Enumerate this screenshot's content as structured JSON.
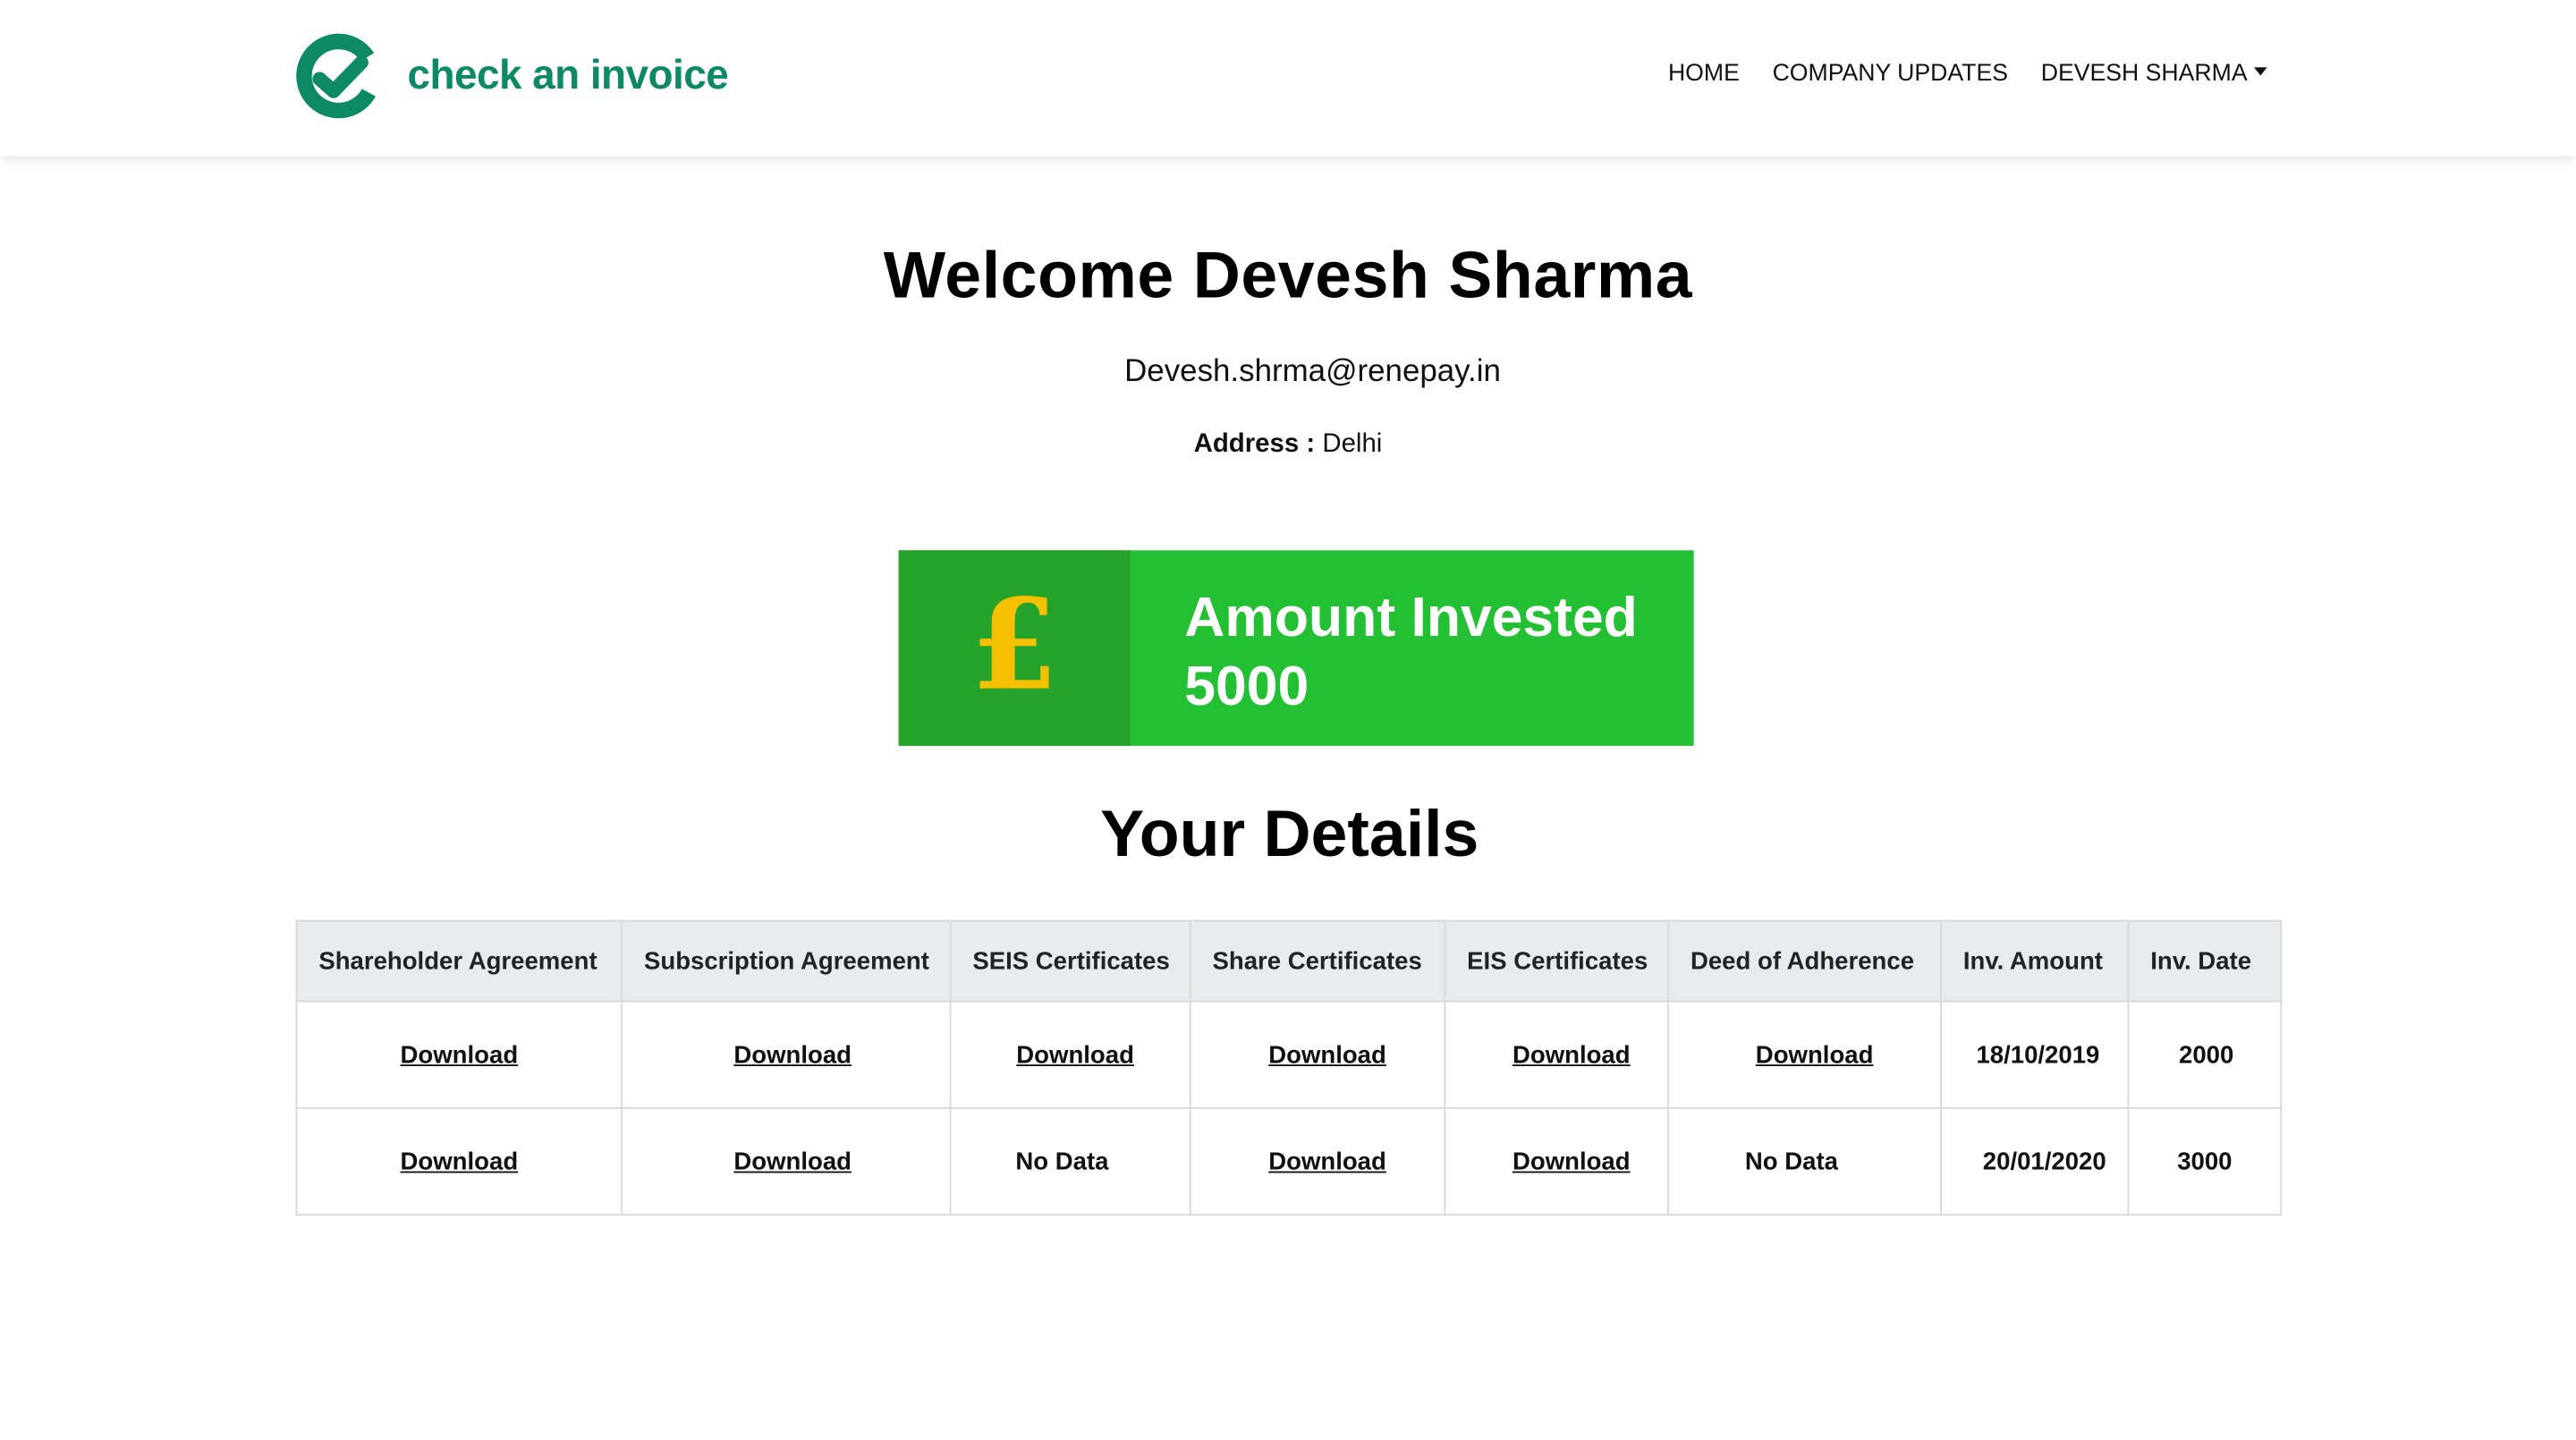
{
  "brand": {
    "name": "check an invoice"
  },
  "nav": {
    "home": "HOME",
    "company_updates": "COMPANY UPDATES",
    "user_menu": "DEVESH SHARMA"
  },
  "profile": {
    "welcome": "Welcome Devesh Sharma",
    "email": "Devesh.shrma@renepay.in",
    "address_label": "Address :",
    "address_value": "Delhi"
  },
  "investment_card": {
    "icon": "pound-icon",
    "symbol": "£",
    "label": "Amount Invested",
    "amount": "5000"
  },
  "details": {
    "title": "Your Details",
    "columns": [
      "Shareholder Agreement",
      "Subscription Agreement",
      "SEIS Certificates",
      "Share Certificates",
      "EIS Certificates",
      "Deed of Adherence",
      "Inv. Amount",
      "Inv. Date"
    ],
    "rows": [
      [
        "Download",
        "Download",
        "Download",
        "Download",
        "Download",
        "Download",
        "18/10/2019",
        "2000"
      ],
      [
        "Download",
        "Download",
        "No Data",
        "Download",
        "Download",
        "No Data",
        "20/01/2020",
        "3000"
      ]
    ]
  },
  "colors": {
    "brand_green": "#0d8a64",
    "card_green": "#22c032",
    "card_icon_green": "#25a32b",
    "pound_yellow": "#f5c000",
    "header_cell_bg": "#e9eaeb"
  }
}
